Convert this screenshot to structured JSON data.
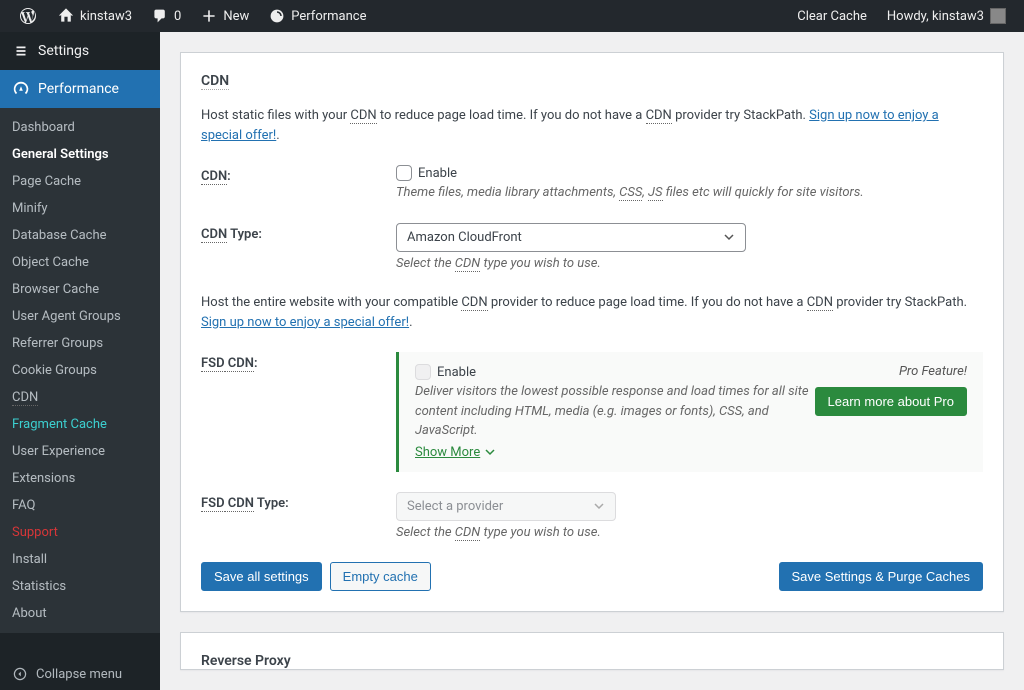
{
  "adminbar": {
    "site_name": "kinstaw3",
    "comments_count": "0",
    "new_label": "New",
    "performance_label": "Performance",
    "clear_cache_label": "Clear Cache",
    "howdy_prefix": "Howdy,",
    "username": "kinstaw3"
  },
  "sidebar": {
    "settings_label": "Settings",
    "performance_label": "Performance",
    "items": [
      {
        "label": "Dashboard",
        "style": "normal"
      },
      {
        "label": "General Settings",
        "style": "active"
      },
      {
        "label": "Page Cache",
        "style": "normal"
      },
      {
        "label": "Minify",
        "style": "normal"
      },
      {
        "label": "Database Cache",
        "style": "normal"
      },
      {
        "label": "Object Cache",
        "style": "normal"
      },
      {
        "label": "Browser Cache",
        "style": "normal"
      },
      {
        "label": "User Agent Groups",
        "style": "normal"
      },
      {
        "label": "Referrer Groups",
        "style": "normal"
      },
      {
        "label": "Cookie Groups",
        "style": "normal"
      },
      {
        "label": "CDN",
        "style": "normal"
      },
      {
        "label": "Fragment Cache",
        "style": "teal"
      },
      {
        "label": "User Experience",
        "style": "normal"
      },
      {
        "label": "Extensions",
        "style": "normal"
      },
      {
        "label": "FAQ",
        "style": "normal"
      },
      {
        "label": "Support",
        "style": "orange"
      },
      {
        "label": "Install",
        "style": "normal"
      },
      {
        "label": "Statistics",
        "style": "normal"
      },
      {
        "label": "About",
        "style": "normal"
      }
    ],
    "collapse_label": "Collapse menu"
  },
  "content": {
    "heading": "CDN",
    "intro_part1": "Host static files with your ",
    "intro_cdn": "CDN",
    "intro_part2": " to reduce page load time. If you do not have a ",
    "intro_part3": " provider try StackPath. ",
    "intro_link": "Sign up now to enjoy a special offer!",
    "intro_period": ".",
    "cdn_label_prefix": "CDN",
    "cdn_label_suffix": ":",
    "enable_label": "Enable",
    "cdn_help_part1": "Theme files, media library attachments, ",
    "cdn_help_css": "CSS",
    "cdn_help_comma": ", ",
    "cdn_help_js": "JS",
    "cdn_help_part2": " files etc will quickly for site visitors.",
    "cdn_type_label_prefix": "CDN",
    "cdn_type_label_suffix": " Type:",
    "cdn_type_value": "Amazon CloudFront",
    "cdn_type_help_part1": "Select the ",
    "cdn_type_help_part2": " type you wish to use.",
    "fsd_intro_part1": "Host the entire website with your compatible ",
    "fsd_intro_part2": " provider to reduce page load time. If you do not have a ",
    "fsd_intro_part3": " provider try StackPath. ",
    "fsd_intro_link": "Sign up now to enjoy a special offer!",
    "fsd_label_prefix1": "FSD",
    "fsd_label_prefix2": " CDN",
    "fsd_label_suffix": ":",
    "fsd_help": "Deliver visitors the lowest possible response and load times for all site content including HTML, media (e.g. images or fonts), CSS, and JavaScript.",
    "show_more_label": "Show More",
    "pro_badge": "Pro Feature!",
    "learn_more_label": "Learn more about Pro",
    "fsd_type_label_prefix1": "FSD",
    "fsd_type_label_prefix2": " CDN",
    "fsd_type_label_suffix": " Type:",
    "fsd_type_placeholder": "Select a provider",
    "fsd_type_help_part1": "Select the ",
    "fsd_type_help_part2": " type you wish to use.",
    "save_all_label": "Save all settings",
    "empty_cache_label": "Empty cache",
    "save_purge_label": "Save Settings & Purge Caches",
    "next_section": "Reverse Proxy"
  }
}
